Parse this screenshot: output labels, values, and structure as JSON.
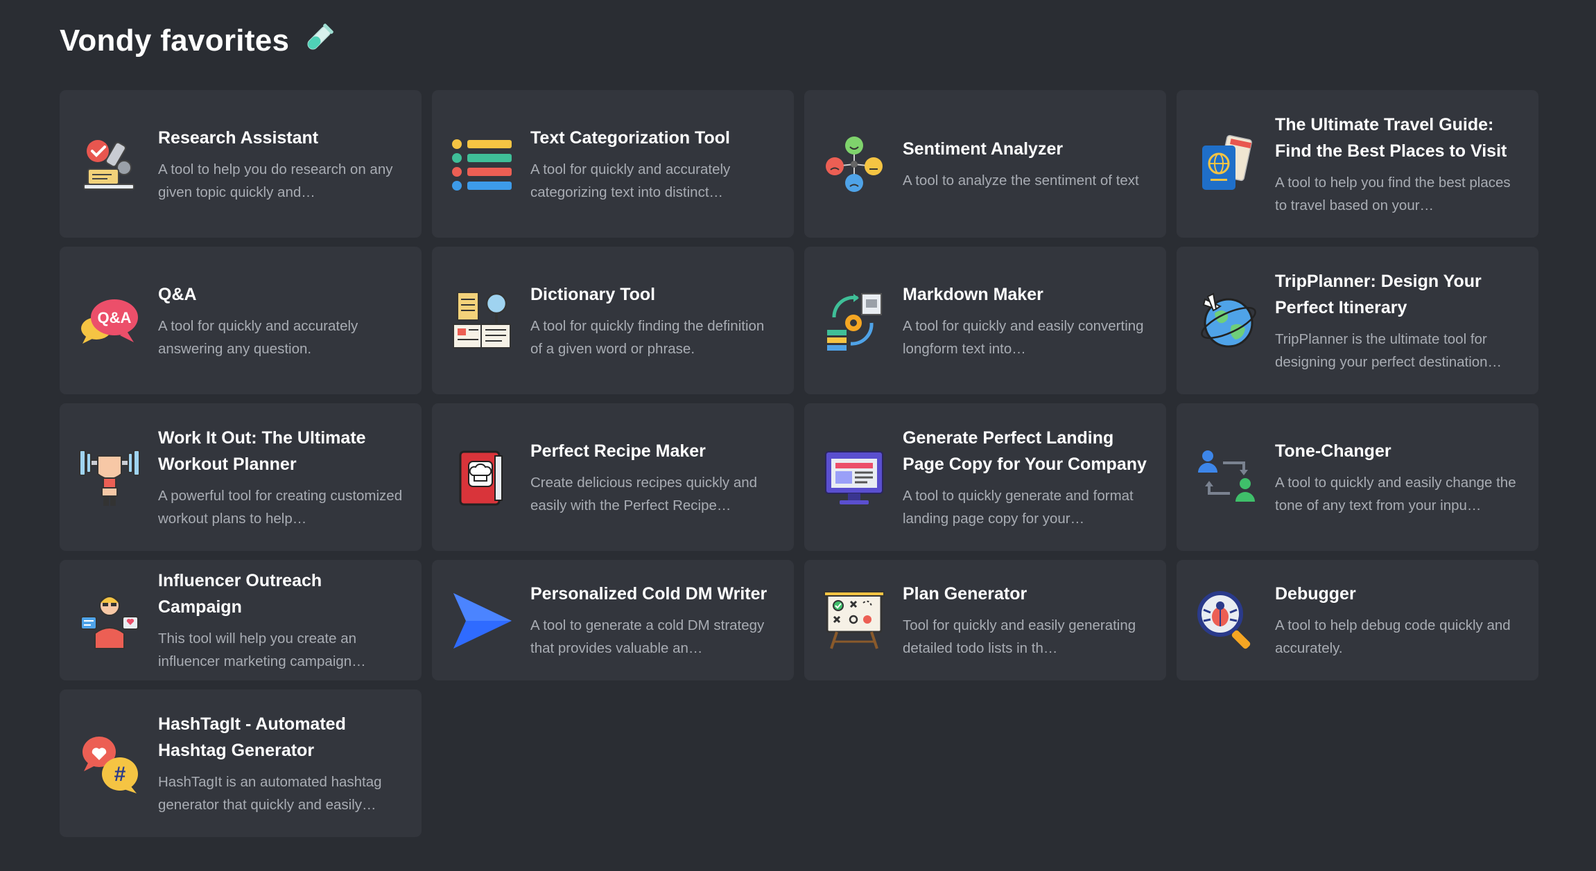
{
  "page": {
    "title": "Vondy favorites",
    "title_icon": "test-tube-icon"
  },
  "cards": [
    {
      "title": "Research Assistant",
      "desc": "A tool to help you do research on any given topic quickly and…",
      "icon": "microscope-icon"
    },
    {
      "title": "Text Categorization Tool",
      "desc": "A tool for quickly and accurately categorizing text into distinct…",
      "icon": "category-list-icon"
    },
    {
      "title": "Sentiment Analyzer",
      "desc": "A tool to analyze the sentiment of text",
      "icon": "emotion-faces-icon"
    },
    {
      "title": "The Ultimate Travel Guide: Find the Best Places to Visit",
      "desc": "A tool to help you find the best places to travel based on your…",
      "icon": "passport-icon"
    },
    {
      "title": "Q&A",
      "desc": "A tool for quickly and accurately answering any question.",
      "icon": "qa-bubble-icon",
      "icon_text": "Q&A"
    },
    {
      "title": "Dictionary Tool",
      "desc": "A tool for quickly finding the definition of a given word or phrase.",
      "icon": "dictionary-icon"
    },
    {
      "title": "Markdown Maker",
      "desc": "A tool for quickly and easily converting longform text into…",
      "icon": "document-convert-icon"
    },
    {
      "title": "TripPlanner: Design Your Perfect Itinerary",
      "desc": "TripPlanner is the ultimate tool for designing your perfect destination…",
      "icon": "globe-plane-icon"
    },
    {
      "title": "Work It Out: The Ultimate Workout Planner",
      "desc": "A powerful tool for creating customized workout plans to help…",
      "icon": "weightlifting-icon"
    },
    {
      "title": "Perfect Recipe Maker",
      "desc": "Create delicious recipes quickly and easily with the Perfect Recipe…",
      "icon": "recipe-book-icon"
    },
    {
      "title": "Generate Perfect Landing Page Copy for Your Company",
      "desc": "A tool to quickly generate and format landing page copy for your…",
      "icon": "monitor-webpage-icon"
    },
    {
      "title": "Tone-Changer",
      "desc": "A tool to quickly and easily change the tone of any text from your inpu…",
      "icon": "people-exchange-icon"
    },
    {
      "title": "Influencer Outreach Campaign",
      "desc": "This tool will help you create an influencer marketing campaign…",
      "icon": "influencer-icon"
    },
    {
      "title": "Personalized Cold DM Writer",
      "desc": "A tool to generate a cold DM strategy that provides valuable an…",
      "icon": "send-arrow-icon"
    },
    {
      "title": "Plan Generator",
      "desc": "Tool for quickly and easily generating detailed todo lists in th…",
      "icon": "strategy-board-icon"
    },
    {
      "title": "Debugger",
      "desc": "A tool to help debug code quickly and accurately.",
      "icon": "bug-search-icon"
    },
    {
      "title": "HashTagIt - Automated Hashtag Generator",
      "desc": "HashTagIt is an automated hashtag generator that quickly and easily…",
      "icon": "hashtag-bubble-icon",
      "icon_text": "#"
    }
  ]
}
